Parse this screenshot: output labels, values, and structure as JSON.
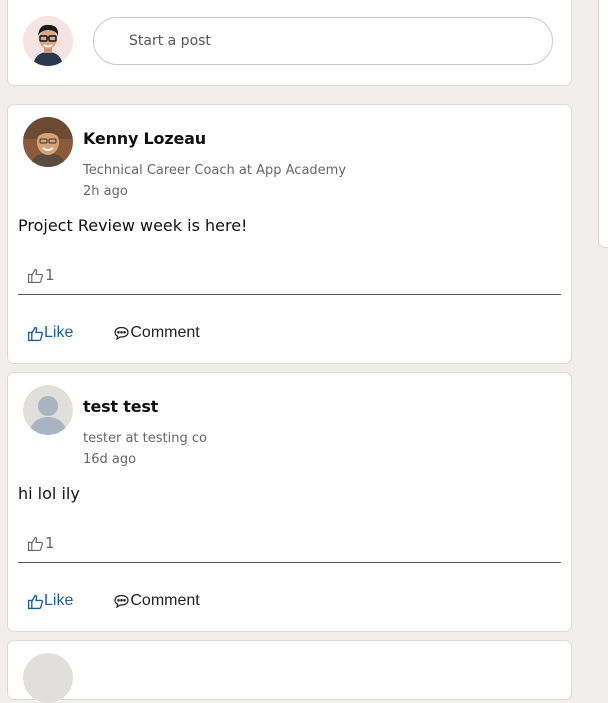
{
  "composer": {
    "placeholder": "Start a post",
    "avatar_icon": "user-avatar"
  },
  "posts": [
    {
      "author": "Kenny Lozeau",
      "headline": "Technical Career Coach at App Academy",
      "time": "2h ago",
      "body": "Project Review week is here!",
      "likes": "1",
      "like_label": "Like",
      "comment_label": "Comment"
    },
    {
      "author": "test test",
      "headline": "tester at testing co",
      "time": "16d ago",
      "body": "hi lol ily",
      "likes": "1",
      "like_label": "Like",
      "comment_label": "Comment"
    }
  ],
  "colors": {
    "accent": "#1d5d9b",
    "background": "#f0efeb"
  }
}
